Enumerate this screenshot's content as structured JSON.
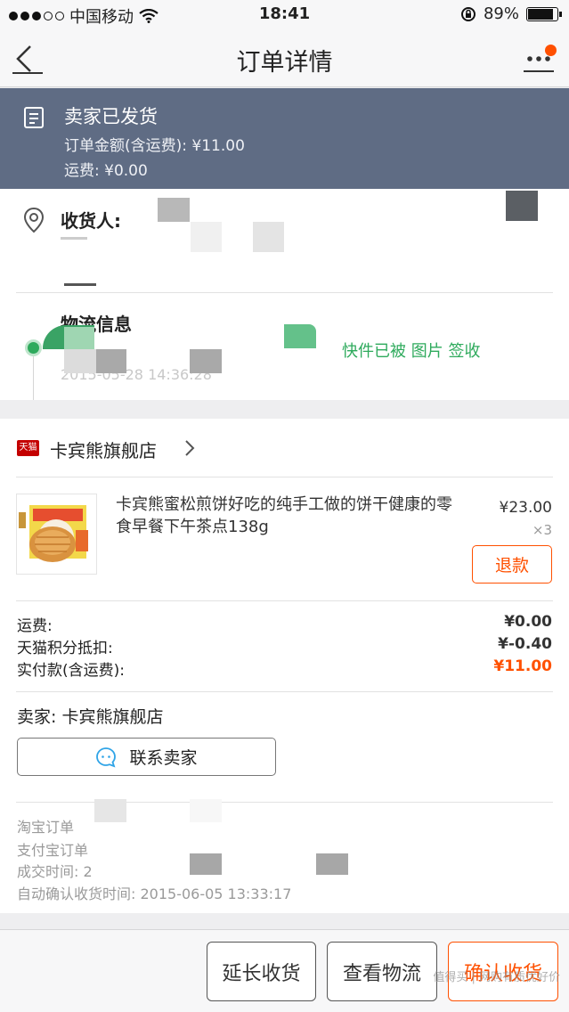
{
  "status_bar": {
    "carrier": "中国移动",
    "time": "18:41",
    "battery": "89%",
    "battery_level": 0.89
  },
  "nav": {
    "title": "订单详情"
  },
  "order_status": {
    "title": "卖家已发货",
    "amount_line": "订单金额(含运费): ¥11.00",
    "shipping_line": "运费: ¥0.00"
  },
  "address": {
    "receiver_label": "收货人:"
  },
  "logistics": {
    "title": "物流信息",
    "latest_status": "快件已被 图片 签收",
    "latest_time": "2015-05-28 14:36:28"
  },
  "store": {
    "badge": "天猫",
    "name": "卡宾熊旗舰店"
  },
  "product": {
    "title": "卡宾熊蜜松煎饼好吃的纯手工做的饼干健康的零食早餐下午茶点138g",
    "price": "¥23.00",
    "quantity": "×3",
    "refund_label": "退款"
  },
  "fees": [
    {
      "label": "运费:",
      "value": "¥0.00",
      "highlight": false
    },
    {
      "label": "天猫积分抵扣:",
      "value": "¥-0.40",
      "highlight": false
    },
    {
      "label": "实付款(含运费):",
      "value": "¥11.00",
      "highlight": true
    }
  ],
  "seller": {
    "label": "卖家: 卡宾熊旗舰店",
    "contact_label": "联系卖家"
  },
  "order_meta": {
    "taobao_order": "淘宝订单",
    "alipay_order": "支付宝订单",
    "deal_time": "成交时间: 2",
    "auto_confirm": "自动确认收货时间: 2015-06-05 13:33:17"
  },
  "bottom_bar": {
    "extend_label": "延长收货",
    "view_logistics_label": "查看物流",
    "confirm_label": "确认收货"
  },
  "watermark": "值得买 | 网购有质优好价",
  "colors": {
    "accent": "#ff5000",
    "banner": "#5f6c84",
    "logistics_green": "#2eaa5c",
    "tmall_red": "#c40000"
  }
}
